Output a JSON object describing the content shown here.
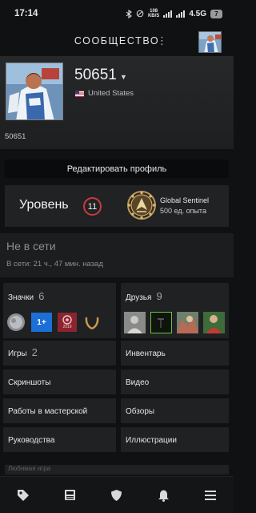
{
  "status_bar": {
    "time": "17:14",
    "speed_value": "108",
    "speed_unit": "KB/S",
    "network": "4.5G",
    "battery": "7"
  },
  "header": {
    "title": "СООБЩЕСТВО",
    "more_icon": "more-vert-icon",
    "avatar_icon": "user-avatar"
  },
  "profile": {
    "name": "50651",
    "country": "United States",
    "id_text": "50651"
  },
  "edit_button_label": "Редактировать профиль",
  "level": {
    "label": "Уровень",
    "value": "11",
    "badge_title": "Global Sentinel",
    "badge_xp": "500 ед. опыта"
  },
  "presence": {
    "status": "Не в сети",
    "last_seen": "В сети: 21 ч., 47 мин. назад"
  },
  "sections": {
    "badges": {
      "label": "Значки",
      "count": "6",
      "mini_label": "1+",
      "year_label": "2019"
    },
    "friends": {
      "label": "Друзья",
      "count": "9"
    },
    "games": {
      "label": "Игры",
      "count": "2"
    },
    "inventory": {
      "label": "Инвентарь"
    },
    "screenshots": {
      "label": "Скриншоты"
    },
    "video": {
      "label": "Видео"
    },
    "workshop": {
      "label": "Работы в мастерской"
    },
    "reviews": {
      "label": "Обзоры"
    },
    "guides": {
      "label": "Руководства"
    },
    "artwork": {
      "label": "Иллюстрации"
    }
  },
  "peek_text": "Любимая игра",
  "tabs": [
    {
      "icon": "tag-icon"
    },
    {
      "icon": "news-icon"
    },
    {
      "icon": "shield-icon"
    },
    {
      "icon": "bell-icon"
    },
    {
      "icon": "menu-icon"
    }
  ],
  "colors": {
    "background": "#101112",
    "panel": "#1f2123",
    "level_ring": "#c83a3a"
  }
}
